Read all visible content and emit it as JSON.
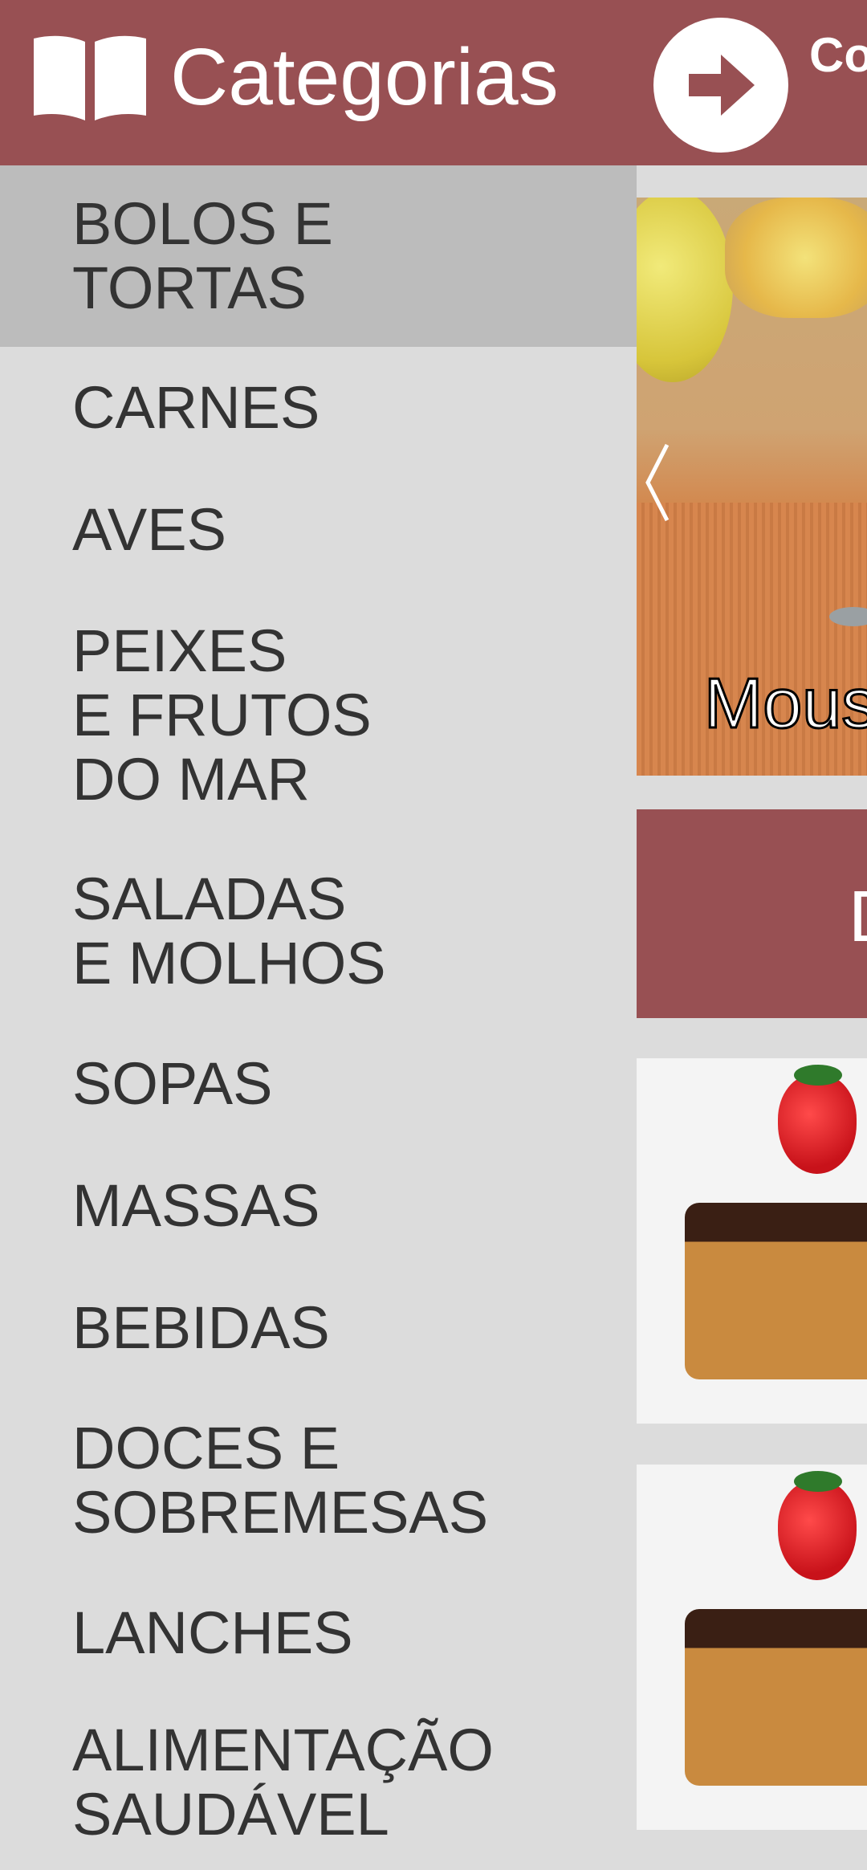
{
  "header": {
    "title": "Categorias",
    "next_text": "Co",
    "colors": {
      "bar": "#985053",
      "text": "#ffffff"
    },
    "icons": {
      "left": "open-book-icon",
      "right": "arrow-right-icon"
    }
  },
  "sidebar": {
    "active_index": 0,
    "items": [
      {
        "label": "BOLOS E\nTORTAS"
      },
      {
        "label": "CARNES"
      },
      {
        "label": "AVES"
      },
      {
        "label": "PEIXES\nE FRUTOS\nDO MAR"
      },
      {
        "label": "SALADAS\nE MOLHOS"
      },
      {
        "label": "SOPAS"
      },
      {
        "label": "MASSAS"
      },
      {
        "label": "BEBIDAS"
      },
      {
        "label": "DOCES E\nSOBREMESAS"
      },
      {
        "label": "LANCHES"
      },
      {
        "label": "ALIMENTAÇÃO\nSAUDÁVEL"
      }
    ]
  },
  "content": {
    "slider_caption": "Mous",
    "section_banner_text": "D",
    "icons": {
      "slider_prev": "chevron-left-icon"
    }
  }
}
